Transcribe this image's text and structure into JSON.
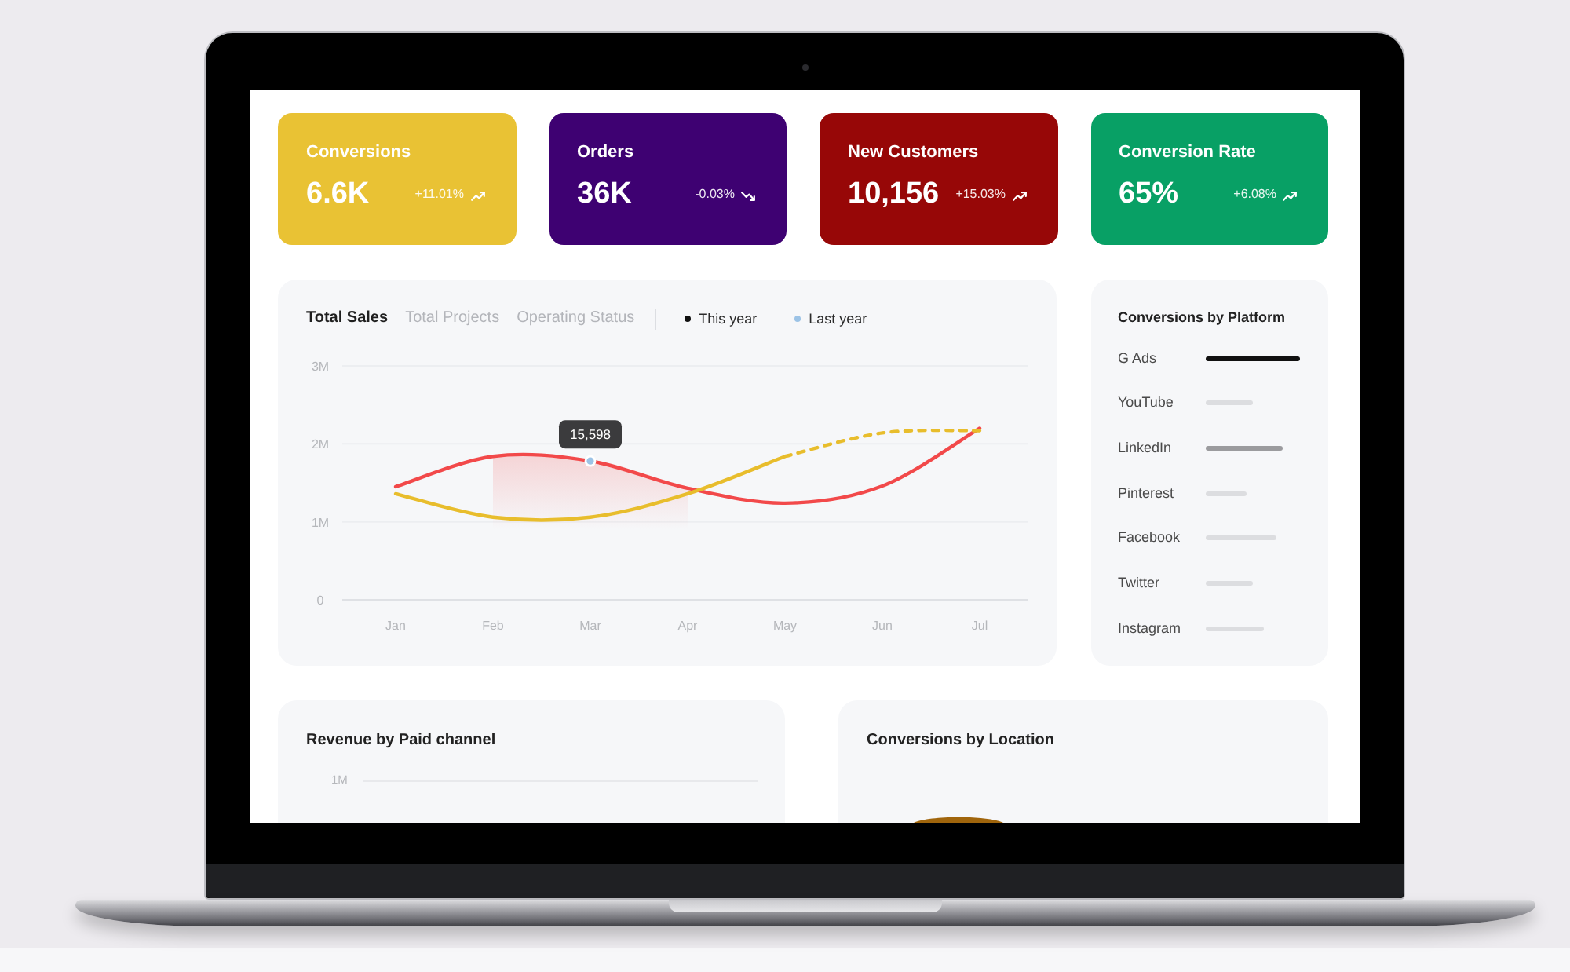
{
  "stats": [
    {
      "title": "Conversions",
      "value": "6.6K",
      "change": "+11.01%",
      "kind": "up",
      "color": "#e9c234"
    },
    {
      "title": "Orders",
      "value": "36K",
      "change": "-0.03%",
      "kind": "down",
      "color": "#3e0172"
    },
    {
      "title": "New Customers",
      "value": "10,156",
      "change": "+15.03%",
      "kind": "up",
      "color": "#970707"
    },
    {
      "title": "Conversion Rate",
      "value": "65%",
      "change": "+6.08%",
      "kind": "up",
      "color": "#08a065"
    }
  ],
  "sales_panel": {
    "tabs": [
      {
        "label": "Total Sales",
        "selected": true
      },
      {
        "label": "Total Projects",
        "selected": false
      },
      {
        "label": "Operating Status",
        "selected": false
      }
    ],
    "legend": [
      {
        "label": "This year",
        "color": "#111111"
      },
      {
        "label": "Last year",
        "color": "#9cc3e6"
      }
    ],
    "chart_data": {
      "type": "line",
      "categories": [
        "Jan",
        "Feb",
        "Mar",
        "Apr",
        "May",
        "Jun",
        "Jul"
      ],
      "ylim": [
        0,
        3
      ],
      "yticks": [
        {
          "value": 0,
          "label": "0"
        },
        {
          "value": 1,
          "label": "1M"
        },
        {
          "value": 2,
          "label": "2M"
        },
        {
          "value": 3,
          "label": "3M"
        }
      ],
      "series": [
        {
          "color": "#f2494a",
          "values": [
            1.45,
            1.84,
            1.78,
            1.43,
            1.24,
            1.46,
            2.2
          ]
        },
        {
          "color": "#e8bd2c",
          "values": [
            1.36,
            1.06,
            1.06,
            1.36,
            1.84,
            null,
            null
          ]
        },
        {
          "color": "#e8bd2c",
          "line_style": "dashed",
          "values": [
            null,
            null,
            null,
            null,
            1.84,
            2.14,
            2.17
          ]
        }
      ],
      "annotations": [
        {
          "x": "Mar",
          "y": 1.78,
          "text": "15,598"
        }
      ]
    }
  },
  "platform": {
    "title": "Conversions by Platform",
    "items": [
      {
        "label": "G Ads",
        "color": "#111111"
      },
      {
        "label": "YouTube",
        "color": "#dcdde0"
      },
      {
        "label": "LinkedIn",
        "color": "#9b9b9e"
      },
      {
        "label": "Pinterest",
        "color": "#dcdde0"
      },
      {
        "label": "Facebook",
        "color": "#dcdde0"
      },
      {
        "label": "Twitter",
        "color": "#dcdde0"
      },
      {
        "label": "Instagram",
        "color": "#dcdde0"
      }
    ]
  },
  "revenue_panel": {
    "title": "Revenue by Paid channel",
    "axis_label": "1M"
  },
  "location_panel": {
    "title": "Conversions by Location"
  }
}
